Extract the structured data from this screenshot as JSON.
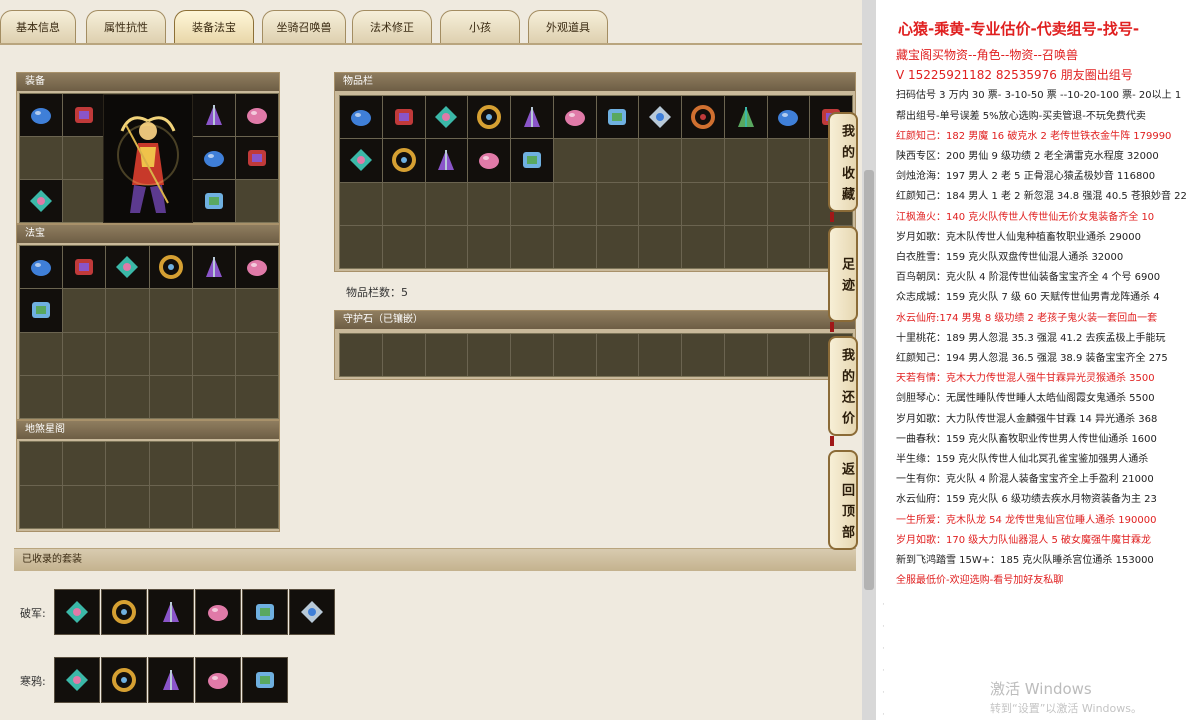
{
  "tabs": [
    {
      "label": "基本信息",
      "active": false
    },
    {
      "label": "属性抗性",
      "active": false
    },
    {
      "label": "装备法宝",
      "active": true
    },
    {
      "label": "坐骑召唤兽",
      "active": false
    },
    {
      "label": "法术修正",
      "active": false
    },
    {
      "label": "小孩",
      "active": false
    },
    {
      "label": "外观道具",
      "active": false
    }
  ],
  "panels": {
    "equip_title": "装备",
    "fabao_title": "法宝",
    "dizhu_title": "地煞星阁",
    "items_title": "物品栏",
    "items_count": "物品栏数：5",
    "guard_title": "守护石（已镶嵌）",
    "sets_title": "已收录的套装",
    "set1_label": "破军:",
    "set2_label": "寒鸦:"
  },
  "side_buttons": {
    "collect": "我的收藏",
    "footprint": "足迹",
    "bargain": "我的还价",
    "top": "返回顶部"
  },
  "notes": {
    "header": "心猿-乘黄-专业估价-代卖组号-找号-",
    "lines": [
      {
        "text": "藏宝阁买物资--角色--物资--召唤兽 ",
        "red": true
      },
      {
        "text": "V 15225921182  82535976 朋友圈出组号",
        "red": true
      },
      {
        "text": "扫码估号 3 万内 30 票- 3-10-50 票  --10-20-100 票- 20以上 1",
        "red": false
      },
      {
        "text": "帮出组号-单号误差 5%放心选购-买卖管退-不玩免费代卖",
        "red": false
      },
      {
        "text": "红颜知己：182 男魔 16 破克水 2 老传世铁衣金牛阵 179990",
        "red": true
      },
      {
        "text": "陕西专区：200 男仙 9 级功绩 2 老全满雷克水程度 32000",
        "red": false
      },
      {
        "text": "剑烛沧海：197 男人 2 老 5 正骨混心猿孟极妙音 116800",
        "red": false
      },
      {
        "text": "红颜知己：184 男人 1 老 2 新忽混 34.8 强混 40.5 苍狼妙音 22",
        "red": false
      },
      {
        "text": "江枫渔火：140 克火队传世人传世仙无价女鬼装备齐全 10",
        "red": true
      },
      {
        "text": "岁月如歌：克木队传世人仙鬼种植畜牧职业通杀 29000",
        "red": false
      },
      {
        "text": "白衣胜雪：159 克火队双盘传世仙混人通杀 32000",
        "red": false
      },
      {
        "text": "百鸟朝凤：克火队 4 阶混传世仙装备宝宝齐全 4 个号 6900",
        "red": false
      },
      {
        "text": "众志成城：159 克火队 7 级 60 天赋传世仙男青龙阵通杀 4",
        "red": false
      },
      {
        "text": "水云仙府:174 男鬼 8 级功绩 2 老孩子鬼火装一套回血一套",
        "red": true
      },
      {
        "text": "十里桃花：189 男人忽混 35.3 强混 41.2 去疾孟极上手能玩",
        "red": false
      },
      {
        "text": "红颜知己：194 男人忽混 36.5 强混 38.9 装备宝宝齐全 275",
        "red": false
      },
      {
        "text": "天若有情：克木大力传世混人强牛甘霖异光灵猴通杀 3500",
        "red": true
      },
      {
        "text": "剑胆琴心：无属性睡队传世睡人太皓仙阁霞女鬼通杀 5500",
        "red": false
      },
      {
        "text": "岁月如歌：大力队传世混人金麟强牛甘霖 14 异光通杀 368",
        "red": false
      },
      {
        "text": "一曲春秋：159 克火队畜牧职业传世男人传世仙通杀 1600",
        "red": false
      },
      {
        "text": "半生缘：159 克火队传世人仙北冥孔雀宝鉴加强男人通杀",
        "red": false
      },
      {
        "text": "一生有你：克火队 4 阶混人装备宝宝齐全上手盈利 21000",
        "red": false
      },
      {
        "text": "水云仙府：159 克火队 6 级功绩去疾水月物资装备为主 23",
        "red": false
      },
      {
        "text": "一生所爱：克木队龙 54 龙传世鬼仙宫位睡人通杀 190000",
        "red": true
      },
      {
        "text": "岁月如歌：170 级大力队仙器混人 5 破女魔强牛魔甘霖龙",
        "red": true
      },
      {
        "text": "新到飞鸿踏雪 15W+：185 克火队睡杀宫位通杀 153000",
        "red": false
      },
      {
        "text": "全服最低价-欢迎选购-看号加好友私聊",
        "red": true
      }
    ],
    "watermark_title": "激活 Windows",
    "watermark_sub": "转到“设置”以激活 Windows。"
  },
  "colors": {
    "accent_red": "#e02020",
    "panel_bg": "#c9b99a",
    "slot_dark": "#120f0c"
  }
}
